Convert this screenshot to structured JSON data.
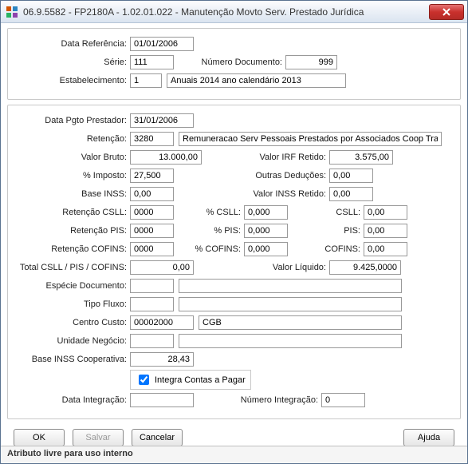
{
  "window": {
    "title": "06.9.5582 - FP2180A - 1.02.01.022 - Manutenção Movto Serv. Prestado Jurídica"
  },
  "header": {
    "data_ref_label": "Data Referência:",
    "data_ref": "01/01/2006",
    "serie_label": "Série:",
    "serie": "111",
    "num_doc_label": "Número Documento:",
    "num_doc": "999",
    "estab_label": "Estabelecimento:",
    "estab": "1",
    "estab_desc": "Anuais 2014 ano calendário 2013"
  },
  "body": {
    "data_pgto_label": "Data Pgto Prestador:",
    "data_pgto": "31/01/2006",
    "retencao_label": "Retenção:",
    "retencao": "3280",
    "retencao_desc": "Remuneracao Serv Pessoais Prestados por Associados Coop Trab",
    "valor_bruto_label": "Valor Bruto:",
    "valor_bruto": "13.000,00",
    "valor_irf_label": "Valor IRF Retido:",
    "valor_irf": "3.575,00",
    "pct_imposto_label": "% Imposto:",
    "pct_imposto": "27,500",
    "outras_ded_label": "Outras Deduções:",
    "outras_ded": "0,00",
    "base_inss_label": "Base INSS:",
    "base_inss": "0,00",
    "valor_inss_ret_label": "Valor INSS Retido:",
    "valor_inss_ret": "0,00",
    "ret_csll_label": "Retenção CSLL:",
    "ret_csll": "0000",
    "pct_csll_label": "% CSLL:",
    "pct_csll": "0,000",
    "csll_label": "CSLL:",
    "csll": "0,00",
    "ret_pis_label": "Retenção PIS:",
    "ret_pis": "0000",
    "pct_pis_label": "% PIS:",
    "pct_pis": "0,000",
    "pis_label": "PIS:",
    "pis": "0,00",
    "ret_cofins_label": "Retenção COFINS:",
    "ret_cofins": "0000",
    "pct_cofins_label": "% COFINS:",
    "pct_cofins": "0,000",
    "cofins_label": "COFINS:",
    "cofins": "0,00",
    "total_label": "Total CSLL / PIS / COFINS:",
    "total": "0,00",
    "valor_liq_label": "Valor Líquido:",
    "valor_liq": "9.425,0000",
    "especie_label": "Espécie Documento:",
    "especie": "",
    "especie_desc": "",
    "tipo_fluxo_label": "Tipo Fluxo:",
    "tipo_fluxo": "",
    "tipo_fluxo_desc": "",
    "centro_custo_label": "Centro Custo:",
    "centro_custo": "00002000",
    "centro_custo_desc": "CGB",
    "unidade_neg_label": "Unidade Negócio:",
    "unidade_neg": "",
    "unidade_neg_desc": "",
    "base_inss_coop_label": "Base INSS Cooperativa:",
    "base_inss_coop": "28,43",
    "integra_label": "Integra Contas a Pagar",
    "data_int_label": "Data Integração:",
    "data_int": "",
    "num_int_label": "Número Integração:",
    "num_int": "0"
  },
  "buttons": {
    "ok": "OK",
    "salvar": "Salvar",
    "cancelar": "Cancelar",
    "ajuda": "Ajuda"
  },
  "status": "Atributo livre para uso interno"
}
